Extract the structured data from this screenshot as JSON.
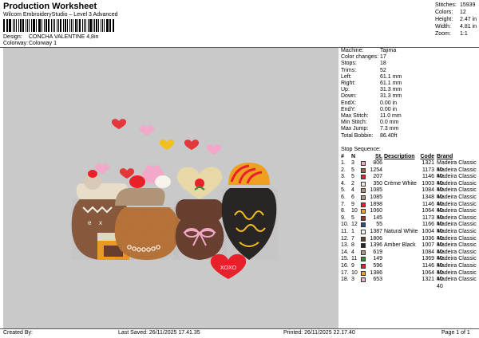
{
  "header": {
    "title": "Production Worksheet",
    "subtitle": "Wilcom EmbroideryStudio – Level 3 Advanced",
    "design_label": "Design:",
    "design_value": "CONCHA VALENTINE 4,8in",
    "colorway_label": "Colorway:",
    "colorway_value": "Colorway 1"
  },
  "stats": {
    "stitches_label": "Stitches:",
    "stitches": "15939",
    "colors_label": "Colors:",
    "colors": "12",
    "height_label": "Height:",
    "height": "2.47 in",
    "width_label": "Width:",
    "width": "4.81 in",
    "zoom_label": "Zoom:",
    "zoom": "1:1"
  },
  "machine_info": [
    {
      "label": "Machine:",
      "value": "Tajima"
    },
    {
      "label": "Color changes:",
      "value": "17"
    },
    {
      "label": "Stops:",
      "value": "18"
    },
    {
      "label": "Trims:",
      "value": "52"
    },
    {
      "label": "Left:",
      "value": "61.1 mm"
    },
    {
      "label": "Right:",
      "value": "61.1 mm"
    },
    {
      "label": "Up:",
      "value": "31.3 mm"
    },
    {
      "label": "Down:",
      "value": "31.3 mm"
    },
    {
      "label": "EndX:",
      "value": "0.00 in"
    },
    {
      "label": "EndY:",
      "value": "0.00 in"
    },
    {
      "label": "Max Stitch:",
      "value": "11.0 mm"
    },
    {
      "label": "Min Stitch:",
      "value": "0.0 mm"
    },
    {
      "label": "Max Jump:",
      "value": "7.3 mm"
    },
    {
      "label": "Total Bobbin:",
      "value": "86.40ft"
    }
  ],
  "stop_sequence": {
    "title": "Stop Sequence:",
    "headers": {
      "num": "#",
      "stop": "N",
      "st": "St.",
      "desc": "Description",
      "code": "Code",
      "brand": "Brand"
    },
    "rows": [
      {
        "num": "1.",
        "stop": "3",
        "color": "#f2a8c8",
        "st": "806",
        "desc": "",
        "code": "1321",
        "brand": "Madeira Classic 40"
      },
      {
        "num": "2.",
        "stop": "5",
        "color": "#a0604a",
        "st": "1254",
        "desc": "",
        "code": "1173",
        "brand": "Madeira Classic 40"
      },
      {
        "num": "3.",
        "stop": "5",
        "color": "#e8202a",
        "st": "207",
        "desc": "",
        "code": "1146",
        "brand": "Madeira Classic 40"
      },
      {
        "num": "4.",
        "stop": "2",
        "color": "#f2ead8",
        "st": "350",
        "desc": "Crème White",
        "code": "1003",
        "brand": "Madeira Classic 40"
      },
      {
        "num": "5.",
        "stop": "4",
        "color": "#b09478",
        "st": "1085",
        "desc": "",
        "code": "1084",
        "brand": "Madeira Classic 40"
      },
      {
        "num": "6.",
        "stop": "6",
        "color": "#b09478",
        "st": "1085",
        "desc": "",
        "code": "1348",
        "brand": "Madeira Classic 40"
      },
      {
        "num": "7.",
        "stop": "9",
        "color": "#e8202a",
        "st": "1898",
        "desc": "",
        "code": "1146",
        "brand": "Madeira Classic 40"
      },
      {
        "num": "8.",
        "stop": "10",
        "color": "#f0a020",
        "st": "1060",
        "desc": "",
        "code": "1064",
        "brand": "Madeira Classic 40"
      },
      {
        "num": "9.",
        "stop": "5",
        "color": "#8a3a28",
        "st": "145",
        "desc": "",
        "code": "1173",
        "brand": "Madeira Classic 40"
      },
      {
        "num": "10.",
        "stop": "12",
        "color": "#2a4a8a",
        "st": "55",
        "desc": "",
        "code": "1166",
        "brand": "Madeira Classic 40"
      },
      {
        "num": "11.",
        "stop": "1",
        "color": "#f8f4ec",
        "st": "1387",
        "desc": "Natural White",
        "code": "1004",
        "brand": "Madeira Classic 40"
      },
      {
        "num": "12.",
        "stop": "7",
        "color": "#6a4030",
        "st": "1806",
        "desc": "",
        "code": "1036",
        "brand": "Madeira Classic 40"
      },
      {
        "num": "13.",
        "stop": "8",
        "color": "#2a2626",
        "st": "1396",
        "desc": "Amber Black",
        "code": "1007",
        "brand": "Madeira Classic 40"
      },
      {
        "num": "14.",
        "stop": "4",
        "color": "#b09478",
        "st": "619",
        "desc": "",
        "code": "1084",
        "brand": "Madeira Classic 40"
      },
      {
        "num": "15.",
        "stop": "11",
        "color": "#3a8a30",
        "st": "149",
        "desc": "",
        "code": "1369",
        "brand": "Madeira Classic 40"
      },
      {
        "num": "16.",
        "stop": "9",
        "color": "#e8202a",
        "st": "596",
        "desc": "",
        "code": "1146",
        "brand": "Madeira Classic 40"
      },
      {
        "num": "17.",
        "stop": "10",
        "color": "#f0a020",
        "st": "1386",
        "desc": "",
        "code": "1064",
        "brand": "Madeira Classic 40"
      },
      {
        "num": "18.",
        "stop": "3",
        "color": "#f2a8c8",
        "st": "653",
        "desc": "",
        "code": "1321",
        "brand": "Madeira Classic 40"
      }
    ]
  },
  "footer": {
    "created_by": "Created By:",
    "last_saved": "Last Saved: 26/11/2025 17.41.35",
    "printed": "Printed: 26/11/2025 22.17.40",
    "page": "Page 1 of 1"
  },
  "canvas": {
    "background": "#c9c9c9",
    "xoxo_text": "XOXO"
  }
}
